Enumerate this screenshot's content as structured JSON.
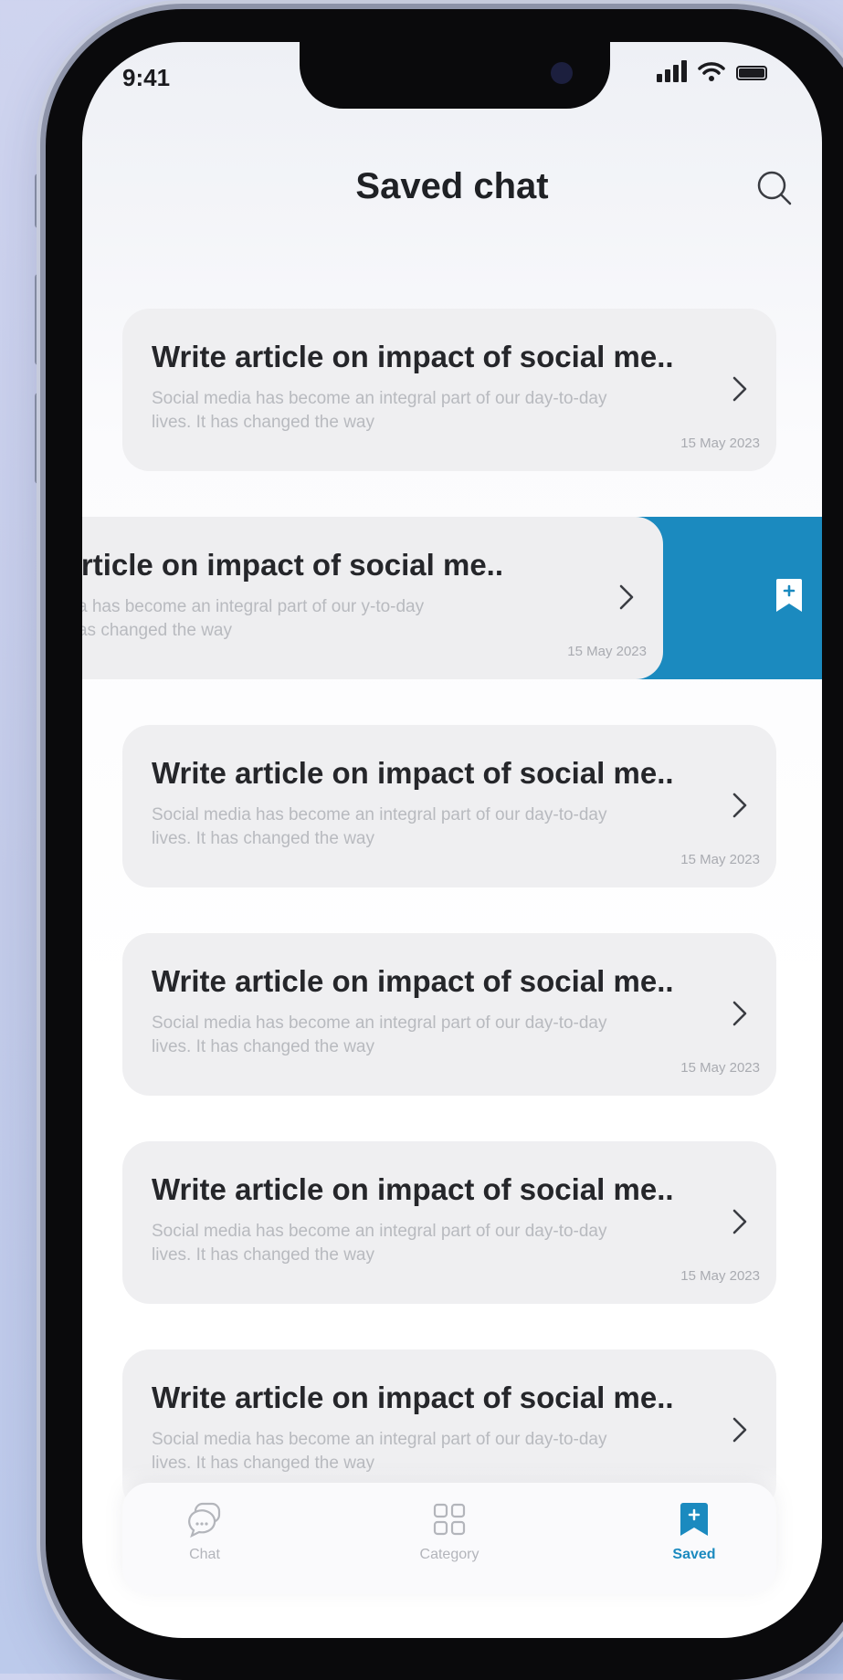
{
  "status_bar": {
    "time": "9:41"
  },
  "header": {
    "title": "Saved chat"
  },
  "chats": [
    {
      "title": "Write article on impact of social me..",
      "preview": "Social media has become an integral part of our day-to-day lives. It has changed the way",
      "date": "15 May 2023",
      "swiped": false
    },
    {
      "title": "rite article on impact of social me..",
      "preview": "cial media has become an integral part of our y-to-day lives. It has changed the way",
      "date": "15 May 2023",
      "swiped": true
    },
    {
      "title": "Write article on impact of social me..",
      "preview": "Social media has become an integral part of our day-to-day lives. It has changed the way",
      "date": "15 May 2023",
      "swiped": false
    },
    {
      "title": "Write article on impact of social me..",
      "preview": "Social media has become an integral part of our day-to-day lives. It has changed the way",
      "date": "15 May 2023",
      "swiped": false
    },
    {
      "title": "Write article on impact of social me..",
      "preview": "Social media has become an integral part of our day-to-day lives. It has changed the way",
      "date": "15 May 2023",
      "swiped": false
    },
    {
      "title": "Write article on impact of social me..",
      "preview": "Social media has become an integral part of our day-to-day lives. It has changed the way",
      "date": "",
      "swiped": false
    }
  ],
  "tabbar": {
    "tabs": [
      {
        "label": "Chat",
        "icon": "chat-bubbles-icon"
      },
      {
        "label": "Category",
        "icon": "grid-icon"
      },
      {
        "label": "Saved",
        "icon": "bookmark-icon",
        "active": true
      }
    ]
  },
  "colors": {
    "accent": "#1b8abf",
    "card": "#eeeef0",
    "title": "#25262a",
    "muted": "#b8babf"
  }
}
